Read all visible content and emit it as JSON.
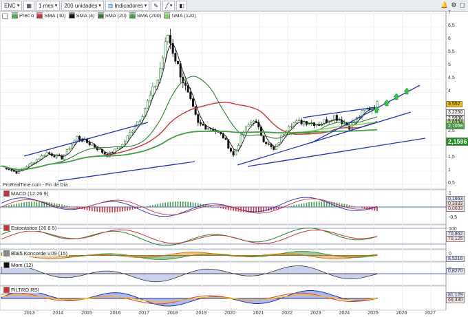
{
  "toolbar": {
    "ticker": "ENC",
    "interval": "1 mes",
    "units": "200 unidades",
    "indicators": "Indicadores"
  },
  "legend": {
    "price": "Precio",
    "items": [
      {
        "label": "SMA (40)",
        "color": "#d32f2f"
      },
      {
        "label": "SMA (4)",
        "color": "#111111"
      },
      {
        "label": "SMA (20)",
        "color": "#2e7d32"
      },
      {
        "label": "SMA (200)",
        "color": "#43a047"
      },
      {
        "label": "SMA (120)",
        "color": "#7ed957"
      }
    ]
  },
  "source_text": "ProRealTime.com - Fin de Día",
  "price_axis": [
    "7",
    "6,5",
    "6",
    "5,5",
    "5",
    "4,5",
    "4",
    "3,5",
    "3",
    "2,5",
    "2",
    "1,5",
    "1",
    "0,5"
  ],
  "price_tags": [
    {
      "value": "3,552",
      "color": "#f7c300",
      "text_color": "#000"
    },
    {
      "value": "3,2250",
      "color": "#fff",
      "text_color": "#000"
    },
    {
      "value": "2,9936",
      "color": "#fff",
      "text_color": "#000"
    },
    {
      "value": "2,8334",
      "color": "#a5e36b",
      "text_color": "#000"
    },
    {
      "value": "2,7058",
      "color": "#43a047",
      "text_color": "#fff"
    },
    {
      "value": "2,1596",
      "color": "#1b8f1b",
      "text_color": "#fff"
    }
  ],
  "panels": {
    "macd": {
      "label": "MACD (12 26 9)",
      "axis": [
        "1",
        "0,5",
        "0",
        "-0,5"
      ],
      "tags": [
        "0,1663",
        "0,3333",
        "0,0033"
      ]
    },
    "stoch": {
      "label": "Estocástico (26 8 5)",
      "axis": [
        "100",
        "50"
      ],
      "tags": [
        "70,862",
        "70,125"
      ]
    },
    "koncorde": {
      "label": "Blai5 Koncorde v.09 (15)",
      "axis": [
        "0"
      ],
      "tags": [
        "8,5216"
      ]
    },
    "mom": {
      "label": "Mom (12)",
      "axis": [
        "0"
      ],
      "tags": [
        "0,8270"
      ]
    },
    "rsi": {
      "label": "FILTRO RSI",
      "axis": [],
      "tags": [
        "81,129",
        "69,430"
      ]
    }
  },
  "years": [
    "2013",
    "2014",
    "2015",
    "2016",
    "2017",
    "2018",
    "2019",
    "2020",
    "2021",
    "2022",
    "2023",
    "2024",
    "2025",
    "2026",
    "2027"
  ],
  "colors": {
    "up": "#2e7d32",
    "down": "#111111",
    "trend": "#1a2fc7"
  }
}
